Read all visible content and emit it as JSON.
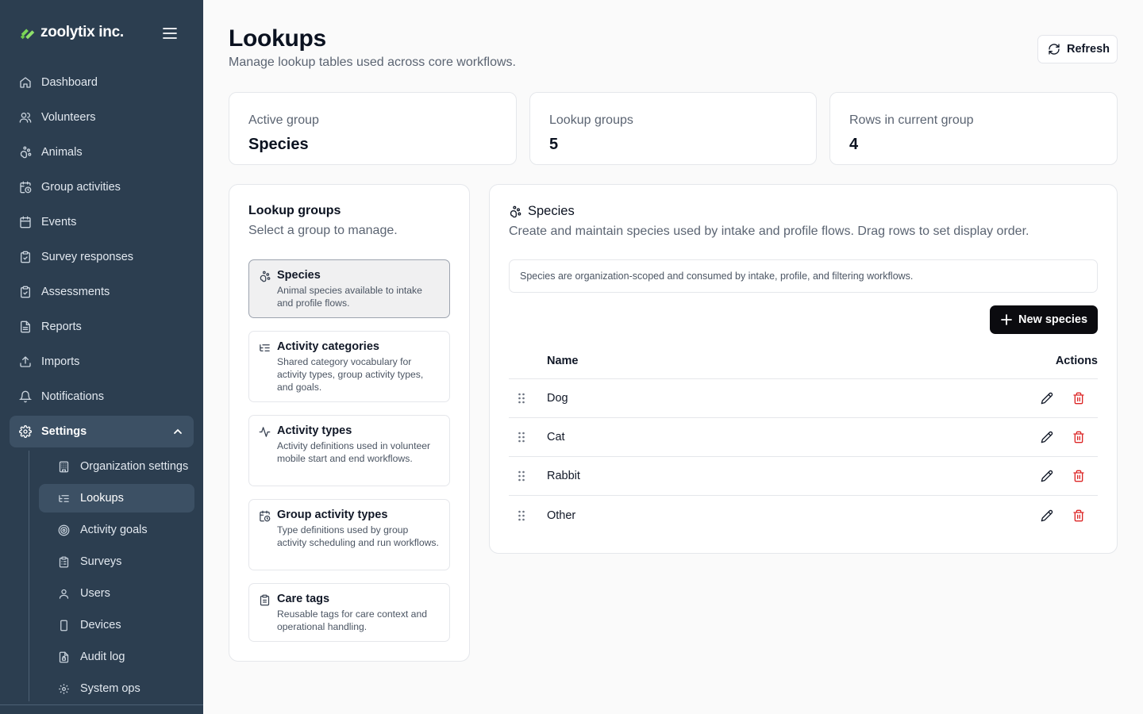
{
  "brand": {
    "name": "zoolytix inc."
  },
  "nav": [
    {
      "label": "Dashboard",
      "icon": "home-icon"
    },
    {
      "label": "Volunteers",
      "icon": "users-icon"
    },
    {
      "label": "Animals",
      "icon": "paw-icon"
    },
    {
      "label": "Group activities",
      "icon": "calendar-clock-icon"
    },
    {
      "label": "Events",
      "icon": "calendar-icon"
    },
    {
      "label": "Survey responses",
      "icon": "clipboard-check-icon"
    },
    {
      "label": "Assessments",
      "icon": "clipboard-check-icon"
    },
    {
      "label": "Reports",
      "icon": "file-text-icon"
    },
    {
      "label": "Imports",
      "icon": "upload-icon"
    },
    {
      "label": "Notifications",
      "icon": "bell-icon"
    },
    {
      "label": "Settings",
      "icon": "gear-icon"
    }
  ],
  "subnav": [
    {
      "label": "Organization settings",
      "icon": "building-icon"
    },
    {
      "label": "Lookups",
      "icon": "list-tree-icon"
    },
    {
      "label": "Activity goals",
      "icon": "target-icon"
    },
    {
      "label": "Surveys",
      "icon": "clipboard-list-icon"
    },
    {
      "label": "Users",
      "icon": "user-icon"
    },
    {
      "label": "Devices",
      "icon": "smartphone-icon"
    },
    {
      "label": "Audit log",
      "icon": "file-lock-icon"
    },
    {
      "label": "System ops",
      "icon": "gear-icon"
    }
  ],
  "page": {
    "title": "Lookups",
    "subtitle": "Manage lookup tables used across core workflows.",
    "refresh_label": "Refresh"
  },
  "stats": [
    {
      "label": "Active group",
      "value": "Species"
    },
    {
      "label": "Lookup groups",
      "value": "5"
    },
    {
      "label": "Rows in current group",
      "value": "4"
    }
  ],
  "groups_panel": {
    "title": "Lookup groups",
    "subtitle": "Select a group to manage.",
    "items": [
      {
        "title": "Species",
        "desc": "Animal species available to intake and profile flows.",
        "icon": "paw-icon",
        "selected": true
      },
      {
        "title": "Activity categories",
        "desc": "Shared category vocabulary for activity types, group activity types, and goals.",
        "icon": "list-tree-icon"
      },
      {
        "title": "Activity types",
        "desc": "Activity definitions used in volunteer mobile start and end workflows.",
        "icon": "activity-icon"
      },
      {
        "title": "Group activity types",
        "desc": "Type definitions used by group activity scheduling and run workflows.",
        "icon": "calendar-clock-icon"
      },
      {
        "title": "Care tags",
        "desc": "Reusable tags for care context and operational handling.",
        "icon": "clipboard-icon"
      }
    ]
  },
  "species_panel": {
    "title": "Species",
    "subtitle": "Create and maintain species used by intake and profile flows. Drag rows to set display order.",
    "note": "Species are organization-scoped and consumed by intake, profile, and filtering workflows.",
    "new_label": "New species",
    "columns": {
      "name": "Name",
      "actions": "Actions"
    },
    "rows": [
      "Dog",
      "Cat",
      "Rabbit",
      "Other"
    ]
  },
  "colors": {
    "sidebar_bg": "#2c3e50",
    "primary_button": "#0b0b0f",
    "danger": "#dc2626"
  }
}
